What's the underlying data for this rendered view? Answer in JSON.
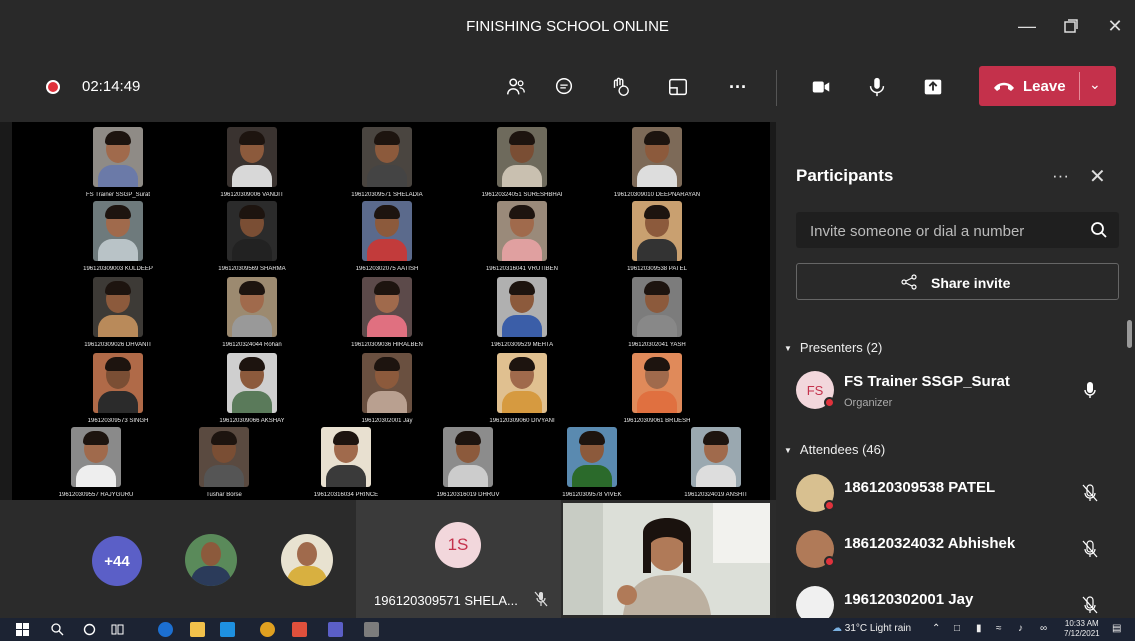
{
  "window": {
    "title": "FINISHING SCHOOL ONLINE"
  },
  "toolbar": {
    "timer": "02:14:49",
    "leave_label": "Leave"
  },
  "grid_tiles": [
    {
      "name": "FS Trainer SSGP_Surat",
      "skin": "#a06a4c",
      "shirt": "#6b7aa8",
      "bg": "#8f8b86"
    },
    {
      "name": "196120309006 VANDIT",
      "skin": "#8c5a3c",
      "shirt": "#d8d8d8",
      "bg": "#3a3330"
    },
    {
      "name": "196120309571 SHELADIA",
      "skin": "#8c5a3c",
      "shirt": "#444",
      "bg": "#4a4540"
    },
    {
      "name": "196120324051 SURESHBHAI",
      "skin": "#7a4e34",
      "shirt": "#c9c0b0",
      "bg": "#6e6a5c"
    },
    {
      "name": "196120309010 DEEPNARAYAN",
      "skin": "#8c5a3c",
      "shirt": "#ddd",
      "bg": "#7d6a58"
    },
    {
      "name": "196120309003 KULDEEP",
      "skin": "#a06a4c",
      "shirt": "#b9c3c7",
      "bg": "#6e7a7c"
    },
    {
      "name": "196120309569 SHARMA",
      "skin": "#7a4e34",
      "shirt": "#222",
      "bg": "#2b2b2b"
    },
    {
      "name": "196120302075 AATISH",
      "skin": "#8c5a3c",
      "shirt": "#c23b3b",
      "bg": "#5b6a8c"
    },
    {
      "name": "196120316041 VRUTIBEN",
      "skin": "#a06a4c",
      "shirt": "#e0a0a0",
      "bg": "#9a8a7a"
    },
    {
      "name": "196120309538 PATEL",
      "skin": "#8c5a3c",
      "shirt": "#333",
      "bg": "#c9a070"
    },
    {
      "name": "196120309026 DHVANIT",
      "skin": "#8c5a3c",
      "shirt": "#b98a5a",
      "bg": "#3d3a36"
    },
    {
      "name": "196120324044 Rohan",
      "skin": "#a06a4c",
      "shirt": "#999",
      "bg": "#9c8a70"
    },
    {
      "name": "196120309036 HIRALBEN",
      "skin": "#a06a4c",
      "shirt": "#e07080",
      "bg": "#5c4a4a"
    },
    {
      "name": "196120309529 MEHTA",
      "skin": "#8c5a3c",
      "shirt": "#3b5ea8",
      "bg": "#b0b0b0"
    },
    {
      "name": "196120302041 YASH",
      "skin": "#8c5a3c",
      "shirt": "#888",
      "bg": "#7c7c7c"
    },
    {
      "name": "196120309573 SINGH",
      "skin": "#7a4e34",
      "shirt": "#2b2b2b",
      "bg": "#b06a48"
    },
    {
      "name": "196120309066 AKSHAY",
      "skin": "#8c5a3c",
      "shirt": "#5a7a5a",
      "bg": "#cfcfcf"
    },
    {
      "name": "196120302001 Jay",
      "skin": "#8c5a3c",
      "shirt": "#b9a090",
      "bg": "#6a5040"
    },
    {
      "name": "196120309060 DIVYANI",
      "skin": "#a06a4c",
      "shirt": "#d69a40",
      "bg": "#e0c090"
    },
    {
      "name": "196120309061 BRIJESH",
      "skin": "#a06a4c",
      "shirt": "#e07040",
      "bg": "#e08a5a"
    },
    {
      "name": "196120309557 RAJYGURU",
      "skin": "#a06a4c",
      "shirt": "#eee",
      "bg": "#8a8a8a"
    },
    {
      "name": "Tushar Borse",
      "skin": "#7a4e34",
      "shirt": "#555",
      "bg": "#5a4a40"
    },
    {
      "name": "196120316034 PRINCE",
      "skin": "#a06a4c",
      "shirt": "#3a3a3a",
      "bg": "#e8e0d0"
    },
    {
      "name": "196120316019 DHRUV",
      "skin": "#8c5a3c",
      "shirt": "#ccc",
      "bg": "#8c8c8c"
    },
    {
      "name": "196120309578 VIVEK",
      "skin": "#8c5a3c",
      "shirt": "#2b6a2b",
      "bg": "#5a8ab0"
    },
    {
      "name": "196120324019 ANSHIT",
      "skin": "#a06a4c",
      "shirt": "#ddd",
      "bg": "#9aa8b0"
    }
  ],
  "strip": {
    "overflow_count": "+44",
    "tile_initials": "1S",
    "tile_name": "196120309571 SHELA..."
  },
  "participants": {
    "title": "Participants",
    "search_placeholder": "Invite someone or dial a number",
    "share_label": "Share invite",
    "presenters_header": "Presenters (2)",
    "attendees_header": "Attendees (46)",
    "presenters": [
      {
        "initials": "FS",
        "name": "FS Trainer SSGP_Surat",
        "role": "Organizer"
      }
    ],
    "attendees": [
      {
        "name": "186120309538 PATEL"
      },
      {
        "name": "186120324032 Abhishek"
      },
      {
        "name": "196120302001 Jay"
      }
    ]
  },
  "taskbar": {
    "weather": "31°C Light rain",
    "time": "10:33 AM",
    "date": "7/12/2021"
  },
  "colors": {
    "leave": "#c4314b",
    "accent": "#5b5fc7",
    "panel": "#292929"
  }
}
